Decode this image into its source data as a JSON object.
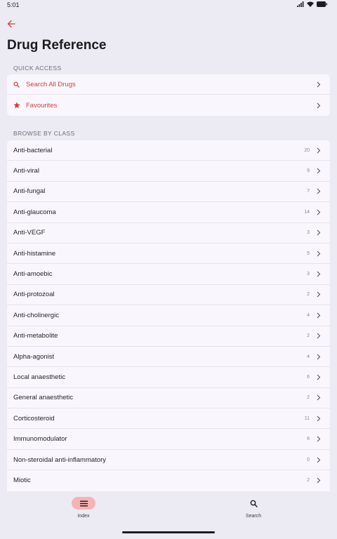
{
  "status": {
    "time": "5:01"
  },
  "header": {
    "title": "Drug Reference"
  },
  "quick_access": {
    "heading": "QUICK ACCESS",
    "items": [
      {
        "label": "Search All Drugs",
        "icon": "search-icon"
      },
      {
        "label": "Favourites",
        "icon": "star-icon"
      }
    ]
  },
  "browse": {
    "heading": "BROWSE BY CLASS",
    "items": [
      {
        "label": "Anti-bacterial",
        "count": "20"
      },
      {
        "label": "Anti-viral",
        "count": "9"
      },
      {
        "label": "Anti-fungal",
        "count": "7"
      },
      {
        "label": "Anti-glaucoma",
        "count": "14"
      },
      {
        "label": "Anti-VEGF",
        "count": "3"
      },
      {
        "label": "Anti-histamine",
        "count": "5"
      },
      {
        "label": "Anti-amoebic",
        "count": "3"
      },
      {
        "label": "Anti-protozoal",
        "count": "2"
      },
      {
        "label": "Anti-cholinergic",
        "count": "4"
      },
      {
        "label": "Anti-metabolite",
        "count": "2"
      },
      {
        "label": "Alpha-agonist",
        "count": "4"
      },
      {
        "label": "Local anaesthetic",
        "count": "6"
      },
      {
        "label": "General anaesthetic",
        "count": "2"
      },
      {
        "label": "Corticosteroid",
        "count": "11"
      },
      {
        "label": "Immunomodulator",
        "count": "6"
      },
      {
        "label": "Non-steroidal anti-inflammatory",
        "count": "0"
      },
      {
        "label": "Miotic",
        "count": "2"
      }
    ]
  },
  "nav": {
    "items": [
      {
        "label": "Index",
        "icon": "menu-icon",
        "active": true
      },
      {
        "label": "Search",
        "icon": "search-icon",
        "active": false
      }
    ]
  },
  "colors": {
    "accent": "#d93a3a",
    "background": "#ecebf3",
    "card": "#f9f7fd",
    "nav_active": "#f5b3b5"
  }
}
